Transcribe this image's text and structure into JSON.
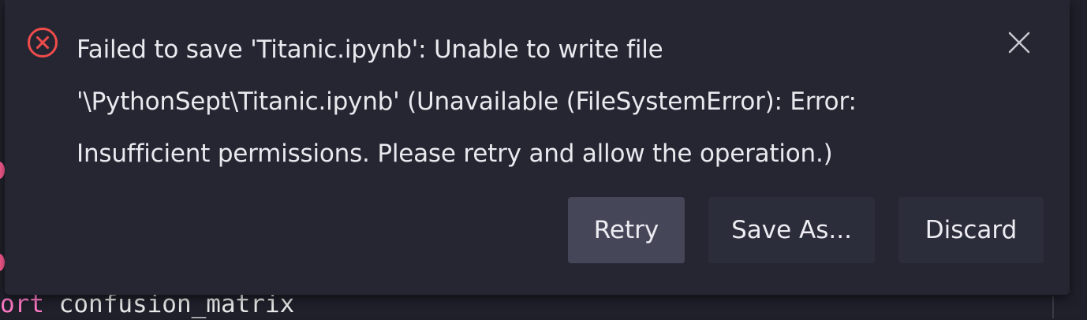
{
  "editor": {
    "code_keyword_fragment": "ort",
    "code_text": " confusion_matrix"
  },
  "notification": {
    "icon": "error-circle-x-icon",
    "message": "Failed to save 'Titanic.ipynb': Unable to write file '\\PythonSept\\Titanic.ipynb' (Unavailable (FileSystemError): Error: Insufficient permissions. Please retry and allow the operation.)",
    "close_icon": "close-icon",
    "buttons": {
      "retry": "Retry",
      "save_as": "Save As...",
      "discard": "Discard"
    }
  },
  "colors": {
    "error_icon": "#f14c4c",
    "toast_background": "#252632",
    "primary_button": "#454759",
    "secondary_button": "#2c2d3a",
    "keyword": "#ff79c6"
  }
}
